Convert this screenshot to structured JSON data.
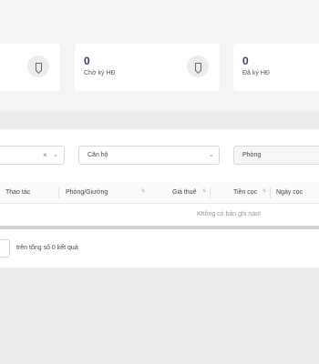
{
  "stats": [
    {
      "value": "",
      "label": "",
      "icon": "bookmark-icon"
    },
    {
      "value": "0",
      "label": "Chờ ký HĐ",
      "icon": "bookmark-icon"
    },
    {
      "value": "0",
      "label": "Đã ký HĐ"
    }
  ],
  "filters": {
    "first_value": "",
    "apartment_select": "Căn hộ",
    "room_input_placeholder": "Phòng"
  },
  "table": {
    "columns": [
      "Thao tác",
      "Phòng/Giường",
      "Giá thuê",
      "Tiền cọc",
      "Ngày cọc"
    ],
    "rows": [],
    "empty_message": "Không có bản ghi nào!"
  },
  "pagination": {
    "summary": "trên tổng số 0 kết quả"
  }
}
